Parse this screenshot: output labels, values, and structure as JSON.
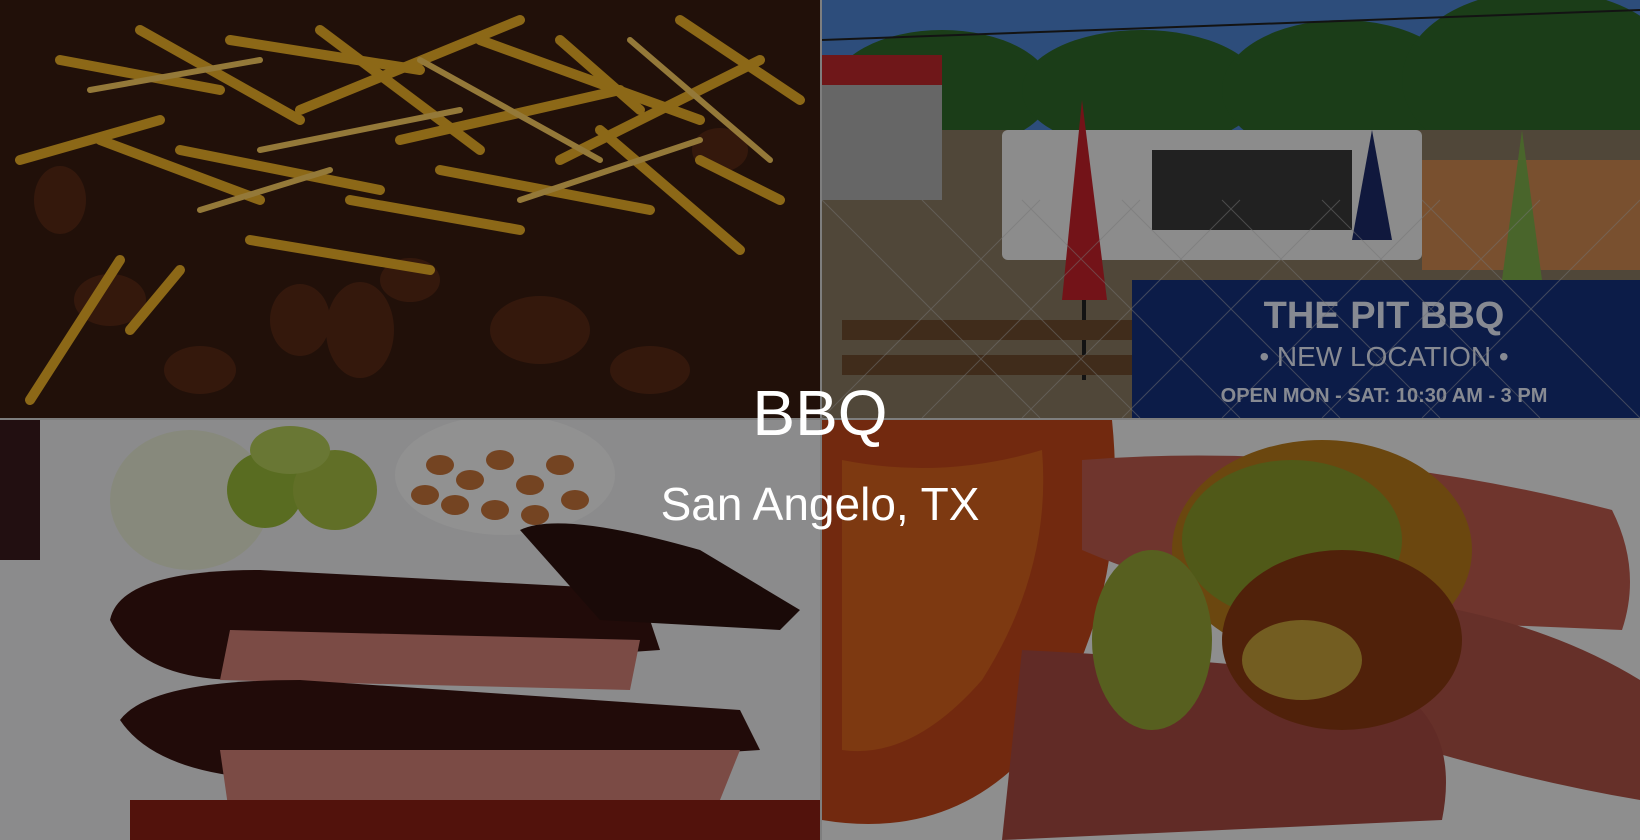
{
  "hero": {
    "title": "BBQ",
    "subtitle": "San Angelo, TX"
  },
  "photos": [
    {
      "name": "chili-beans-cheese-photo"
    },
    {
      "name": "the-pit-bbq-truck-photo"
    },
    {
      "name": "ribs-plate-photo"
    },
    {
      "name": "sausage-pickles-sauce-photo"
    }
  ],
  "sign": {
    "line1": "THE PIT BBQ",
    "line2": "• NEW LOCATION •",
    "line3": "OPEN MON - SAT:  10:30 AM - 3 PM"
  }
}
